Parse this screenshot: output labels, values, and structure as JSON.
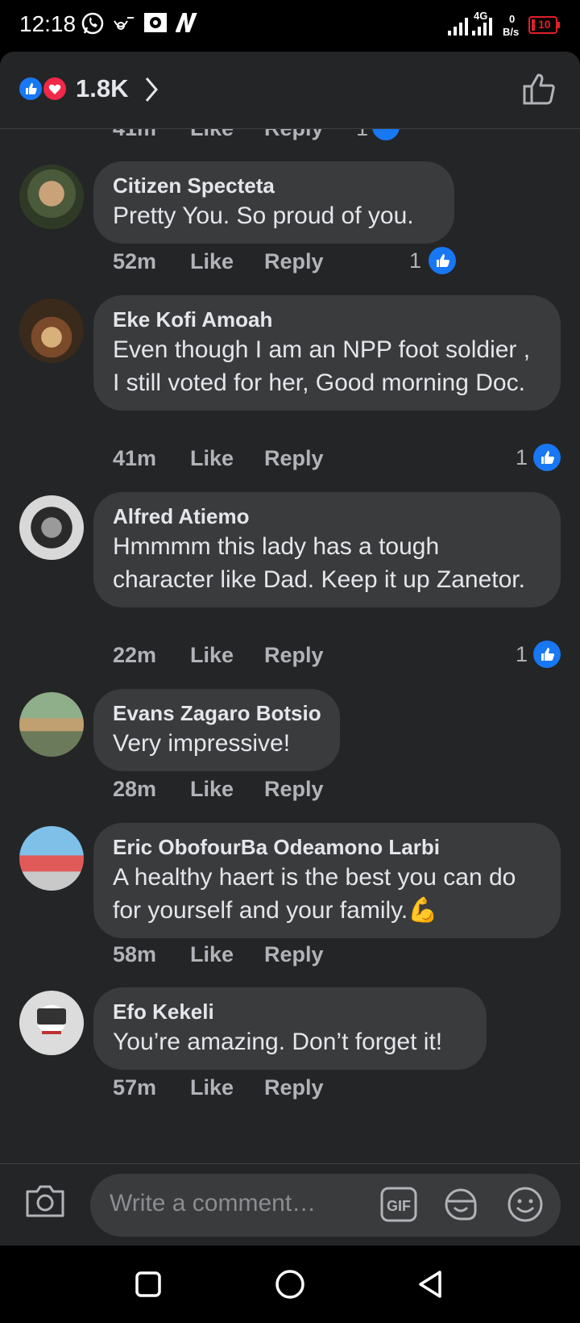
{
  "status_bar": {
    "time": "12:18",
    "network": "4G",
    "data_rate_value": "0",
    "data_rate_unit": "B/s",
    "battery": "10"
  },
  "header": {
    "reaction_count": "1.8K"
  },
  "partial_row": {
    "time": "41m",
    "like": "Like",
    "reply": "Reply",
    "likes": "1"
  },
  "comments": [
    {
      "author": "Citizen Specteta",
      "text": "Pretty You. So proud of you.",
      "time": "52m",
      "like": "Like",
      "reply": "Reply",
      "likes": "1"
    },
    {
      "author": "Eke Kofi Amoah",
      "text": "Even though I am an NPP foot soldier , I still  voted for her, Good morning Doc.",
      "time": "41m",
      "like": "Like",
      "reply": "Reply",
      "likes": "1"
    },
    {
      "author": "Alfred Atiemo",
      "text": "Hmmmm this lady has a tough character like Dad. Keep it up Zanetor.",
      "time": "22m",
      "like": "Like",
      "reply": "Reply",
      "likes": "1"
    },
    {
      "author": "Evans Zagaro Botsio",
      "text": "Very impressive!",
      "time": "28m",
      "like": "Like",
      "reply": "Reply",
      "likes": ""
    },
    {
      "author": "Eric ObofourBa Odeamono Larbi",
      "text": "A healthy haert is the best you can do for yourself and your family.",
      "time": "58m",
      "like": "Like",
      "reply": "Reply",
      "likes": "",
      "emoji": "💪"
    },
    {
      "author": "Efo Kekeli",
      "text": "You’re amazing. Don’t forget it!",
      "time": "57m",
      "like": "Like",
      "reply": "Reply",
      "likes": ""
    }
  ],
  "composer": {
    "placeholder": "Write a comment…",
    "gif_label": "GIF"
  },
  "colors": {
    "background": "#242526",
    "bubble": "#3a3b3c",
    "accent": "#1877f2",
    "love": "#f02849",
    "battery_low": "#e0202a"
  },
  "icons": [
    "whatsapp-icon",
    "antenna-icon",
    "app-icon",
    "netflix-icon",
    "signal-icon",
    "battery-icon",
    "like-reaction-icon",
    "love-reaction-icon",
    "chevron-right-icon",
    "thumbs-up-outline-icon",
    "camera-icon",
    "gif-icon",
    "sticker-icon",
    "emoji-icon",
    "nav-recents-icon",
    "nav-home-icon",
    "nav-back-icon"
  ]
}
